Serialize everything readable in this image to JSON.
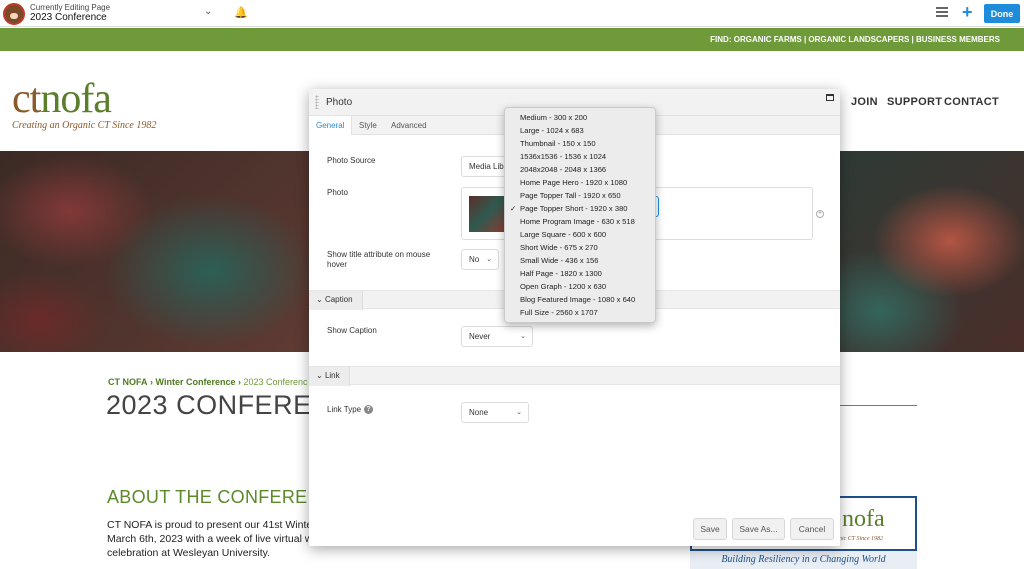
{
  "editor_bar": {
    "subtitle": "Currently Editing Page",
    "title": "2023 Conference",
    "done_label": "Done"
  },
  "find_bar": {
    "text": "FIND: ORGANIC FARMS | ORGANIC LANDSCAPERS | BUSINESS MEMBERS"
  },
  "logo": {
    "part1": "ct",
    "part2": "nofa",
    "tagline": "Creating an Organic CT Since 1982"
  },
  "nav": {
    "join": "JOIN",
    "support": "SUPPORT",
    "contact": "CONTACT"
  },
  "breadcrumb": {
    "home": "CT NOFA",
    "sep1": "›",
    "parent": "Winter Conference",
    "sep2": "›",
    "current": "2023 Conferenc"
  },
  "page_title": "2023 CONFERE",
  "about_heading": "ABOUT THE CONFERE",
  "body_text": "CT NOFA is proud to present our 41st Winter March 6th, 2023 with a week of live virtual w celebration at Wesleyan University.",
  "promo": {
    "logo": "nofa",
    "since": "n Organic CT Since 1982",
    "tagline": "Building Resiliency in a Changing World"
  },
  "modal": {
    "title": "Photo",
    "tabs": [
      "General",
      "Style",
      "Advanced"
    ],
    "photo_source_label": "Photo Source",
    "photo_source_value": "Media Libr",
    "photo_label": "Photo",
    "title_attr_label": "Show title attribute on mouse hover",
    "title_attr_value": "No",
    "caption_section": "Caption",
    "show_caption_label": "Show Caption",
    "show_caption_value": "Never",
    "link_section": "Link",
    "link_type_label": "Link Type",
    "link_type_value": "None",
    "buttons": {
      "save": "Save",
      "save_as": "Save As...",
      "cancel": "Cancel"
    }
  },
  "size_dropdown": {
    "selected": "Page Topper Short - 1920 x 380",
    "options": [
      "Medium - 300 x 200",
      "Large - 1024 x 683",
      "Thumbnail - 150 x 150",
      "1536x1536 - 1536 x 1024",
      "2048x2048 - 2048 x 1366",
      "Home Page Hero - 1920 x 1080",
      "Page Topper Tall - 1920 x 650",
      "Page Topper Short - 1920 x 380",
      "Home Program Image - 630 x 518",
      "Large Square - 600 x 600",
      "Short Wide - 675 x 270",
      "Small Wide - 436 x 156",
      "Half Page - 1820 x 1300",
      "Open Graph - 1200 x 630",
      "Blog Featured Image - 1080 x 640",
      "Full Size - 2560 x 1707"
    ]
  },
  "colors": {
    "accent_blue": "#1e8cda",
    "brand_green": "#6e9a3a",
    "brand_brown": "#8b5a2b"
  }
}
